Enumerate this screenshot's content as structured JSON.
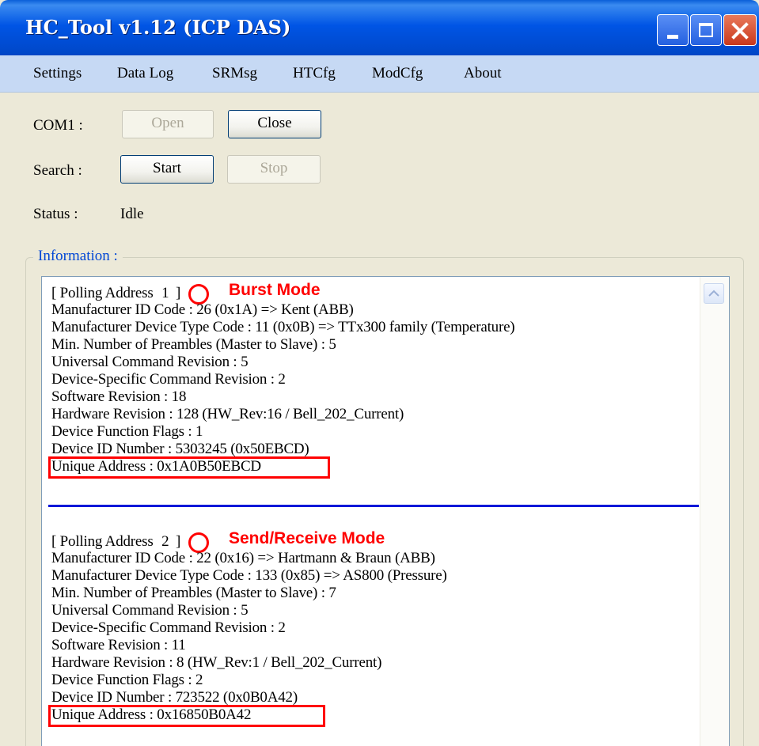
{
  "window": {
    "title": "HC_Tool v1.12  (ICP DAS)"
  },
  "menu": [
    "Settings",
    "Data Log",
    "SRMsg",
    "HTCfg",
    "ModCfg",
    "About"
  ],
  "com": {
    "label": "COM1 :",
    "open_label": "Open",
    "close_label": "Close"
  },
  "search": {
    "label": "Search :",
    "start_label": "Start",
    "stop_label": "Stop"
  },
  "status": {
    "label": "Status :",
    "value": "Idle"
  },
  "information": {
    "label": "Information :",
    "devices": [
      {
        "polling_prefix": "[ Polling Address",
        "polling_number": "1",
        "polling_suffix": "]",
        "mode": "Burst Mode",
        "lines": [
          "Manufacturer ID Code : 26 (0x1A) => Kent (ABB)",
          "Manufacturer Device Type Code : 11 (0x0B) => TTx300 family (Temperature)",
          "Min. Number of Preambles (Master to Slave) : 5",
          "Universal Command Revision : 5",
          "Device-Specific Command Revision : 2",
          "Software Revision : 18",
          "Hardware Revision : 128 (HW_Rev:16 / Bell_202_Current)",
          "Device Function Flags : 1",
          "Device ID Number : 5303245 (0x50EBCD)",
          "Unique Address : 0x1A0B50EBCD"
        ]
      },
      {
        "polling_prefix": "[ Polling Address",
        "polling_number": "2",
        "polling_suffix": "]",
        "mode": "Send/Receive Mode",
        "lines": [
          "Manufacturer ID Code : 22 (0x16) => Hartmann & Braun (ABB)",
          "Manufacturer Device Type Code : 133 (0x85) => AS800 (Pressure)",
          "Min. Number of Preambles (Master to Slave) : 7",
          "Universal Command Revision : 5",
          "Device-Specific Command Revision : 2",
          "Software Revision : 11",
          "Hardware Revision : 8 (HW_Rev:1 / Bell_202_Current)",
          "Device Function Flags : 2",
          "Device ID Number : 723522 (0x0B0A42)",
          "Unique Address : 0x16850B0A42"
        ]
      }
    ]
  },
  "colors": {
    "titlebar": "#0055e5",
    "menubar": "#c6d9f4",
    "annotation": "#ff0000",
    "separator": "#0018d8",
    "group_title": "#0046d5"
  }
}
